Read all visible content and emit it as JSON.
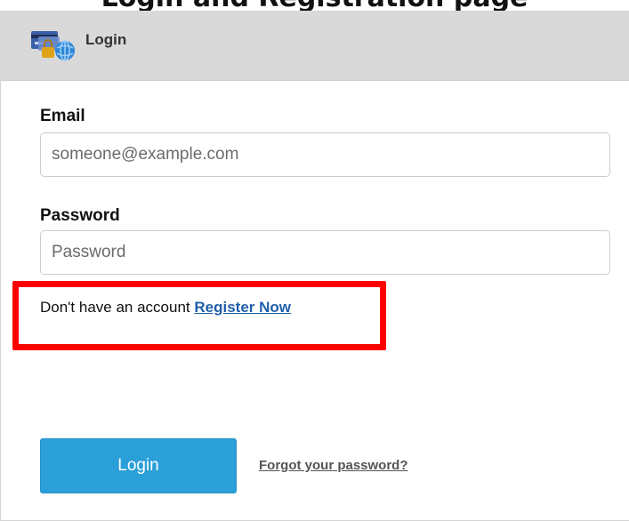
{
  "top_caption": "Login and Registration page",
  "header": {
    "title": "Login",
    "icon": "credit-card-globe-lock-icon"
  },
  "form": {
    "email_label": "Email",
    "email_placeholder": "someone@example.com",
    "password_label": "Password",
    "password_placeholder": "Password",
    "register_prompt": "Don't have an account ",
    "register_link": "Register Now",
    "login_button": "Login",
    "forgot_link": "Forgot your password?"
  },
  "colors": {
    "header_bg": "#d9d9d9",
    "button_bg": "#2a9fd8",
    "link": "#1f5faa",
    "highlight": "#ff0000"
  }
}
